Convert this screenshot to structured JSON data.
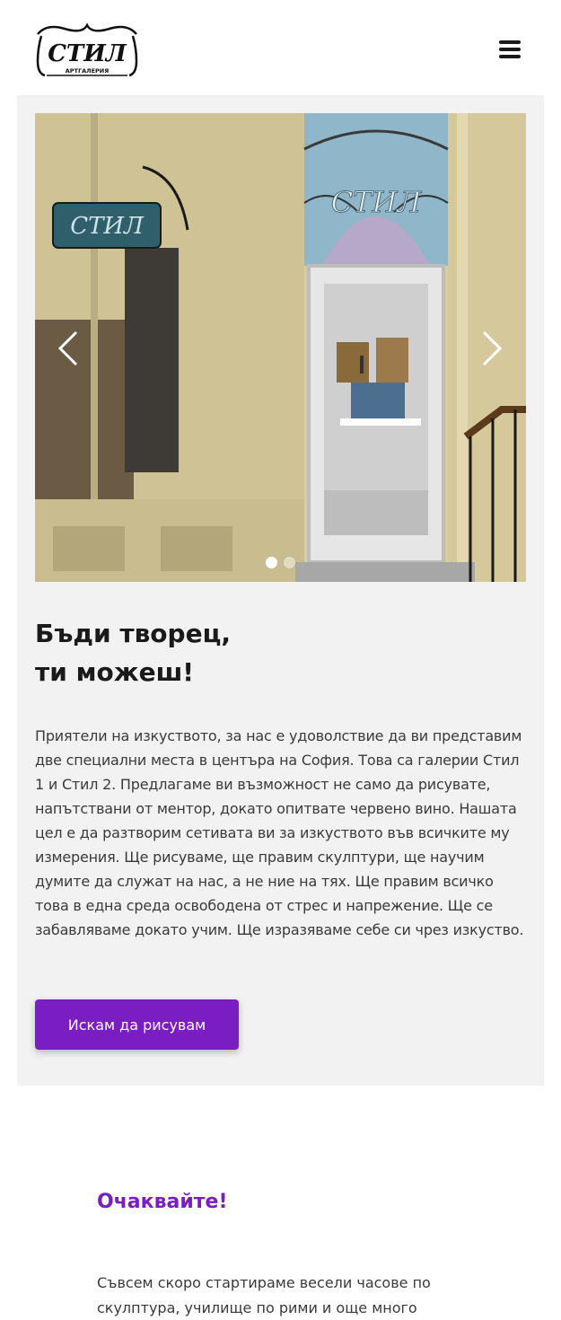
{
  "header": {
    "logo_text": "СТИЛ",
    "logo_subtitle": "АРТГАЛЕРИЯ"
  },
  "slider": {
    "slide_count": 2,
    "active_slide": 1,
    "sign_text": "СТИЛ",
    "window_text": "СТИЛ"
  },
  "hero": {
    "title_line1": "Бъди творец,",
    "title_line2": "ти можеш!",
    "text": "Приятели на изкуството, за нас е удоволствие да ви представим две специални места в центъра на София. Това са галерии Стил 1 и Стил 2. Предлагаме ви възможност не само да рисувате, напътствани от ментор, докато опитвате червено вино. Нашата цел е да разтворим сетивата ви за изкуството във всичките му измерения. Ще рисуваме, ще правим скулптури, ще научим думите да служат на нас, а не ние на тях.  Ще правим всичко това в една среда освободена от стрес и напрежение. Ще се забавляваме докато учим. Ще изразяваме себе си чрез изкуство.",
    "cta_label": "Искам да рисувам"
  },
  "coming_soon": {
    "title": "Очаквайте!",
    "text": "Съвсем скоро стартираме весели часове по скулптура, училище по рими и още много"
  },
  "colors": {
    "accent": "#7a1ec4",
    "section_bg": "#f2f2f2"
  }
}
